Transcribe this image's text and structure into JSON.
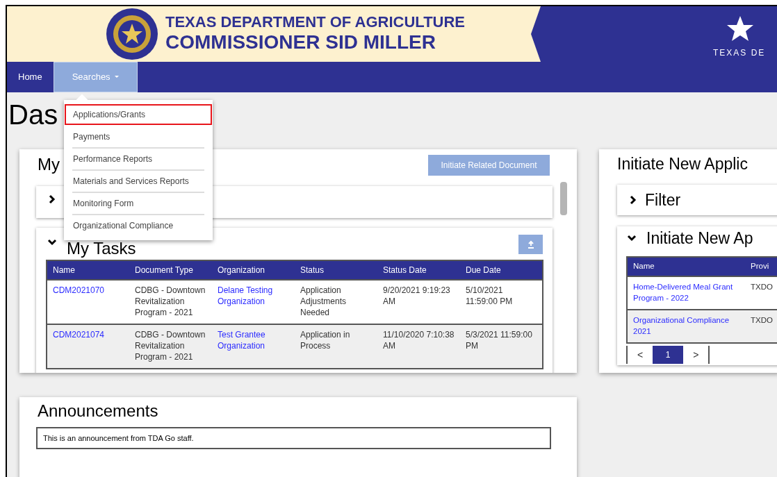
{
  "header": {
    "title_line_1": "TEXAS DEPARTMENT OF AGRICULTURE",
    "title_line_2": "COMMISSIONER SID MILLER",
    "right_text": "TEXAS DE"
  },
  "nav": [
    {
      "label": "Home",
      "selected": false,
      "dropdown": false
    },
    {
      "label": "Searches",
      "selected": true,
      "dropdown": true
    }
  ],
  "dropdown": {
    "open": true,
    "items": [
      {
        "label": "Applications/Grants",
        "highlighted": true
      },
      {
        "label": "Payments",
        "highlighted": false
      },
      {
        "label": "Performance Reports",
        "highlighted": false
      },
      {
        "label": "Materials and Services Reports",
        "highlighted": false
      },
      {
        "label": "Monitoring Form",
        "highlighted": false
      },
      {
        "label": "Organizational Compliance",
        "highlighted": false
      }
    ]
  },
  "page_title": "Das",
  "my_panel": {
    "title": "My",
    "button": "Initiate Related Document",
    "collapsed_section": {
      "expanded": false
    },
    "tasks": {
      "title": "My Tasks",
      "expanded": true,
      "columns": [
        "Name",
        "Document Type",
        "Organization",
        "Status",
        "Status Date",
        "Due Date"
      ],
      "rows": [
        [
          {
            "text": "CDM2021070",
            "kind": "link"
          },
          {
            "text": "CDBG - Downtown Revitalization Program - 2021",
            "kind": "text"
          },
          {
            "text": "Delane Testing Organization",
            "kind": "link"
          },
          {
            "text": "Application Adjustments Needed",
            "kind": "text"
          },
          {
            "text": "9/20/2021 9:19:23 AM",
            "kind": "text"
          },
          {
            "text": "5/10/2021 11:59:00 PM",
            "kind": "text"
          }
        ],
        [
          {
            "text": "CDM2021074",
            "kind": "link"
          },
          {
            "text": "CDBG - Downtown Revitalization Program - 2021",
            "kind": "text"
          },
          {
            "text": "Test Grantee Organization",
            "kind": "link"
          },
          {
            "text": "Application in Process",
            "kind": "text"
          },
          {
            "text": "11/10/2020 7:10:38 AM",
            "kind": "text"
          },
          {
            "text": "5/3/2021 11:59:00 PM",
            "kind": "text"
          }
        ]
      ]
    }
  },
  "initiate_panel": {
    "title": "Initiate New Applic",
    "filter": {
      "label": "Filter",
      "expanded": false
    },
    "section": {
      "title": "Initiate New Ap",
      "expanded": true,
      "columns": [
        "Name",
        "Provi"
      ],
      "rows": [
        [
          {
            "text": "Home-Delivered Meal Grant Program - 2022",
            "kind": "link"
          },
          {
            "text": "TXDO",
            "kind": "text"
          }
        ],
        [
          {
            "text": "Organizational Compliance 2021",
            "kind": "link"
          },
          {
            "text": "TXDO",
            "kind": "text"
          }
        ]
      ]
    },
    "pagination": {
      "prev": "<",
      "next": ">",
      "pages": [
        {
          "label": "1",
          "selected": true
        }
      ]
    }
  },
  "announcements": {
    "title": "Announcements",
    "text": "This is an announcement from TDA Go staff."
  }
}
